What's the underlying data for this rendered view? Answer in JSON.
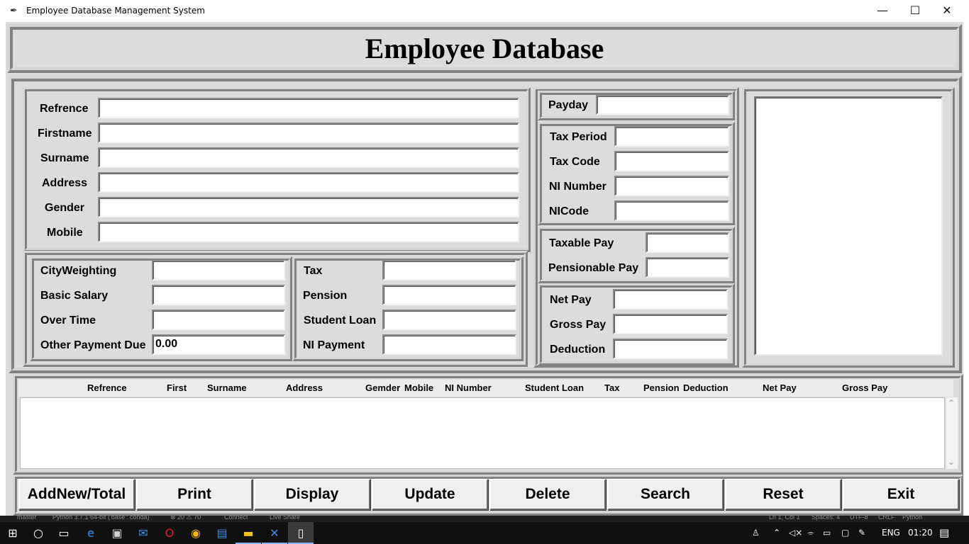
{
  "window": {
    "title": "Employee Database Management System",
    "minimize": "—",
    "maximize": "☐",
    "close": "✕"
  },
  "header": {
    "title": "Employee Database"
  },
  "personal": {
    "fields": [
      {
        "label": "Refrence",
        "value": ""
      },
      {
        "label": "Firstname",
        "value": ""
      },
      {
        "label": "Surname",
        "value": ""
      },
      {
        "label": "Address",
        "value": ""
      },
      {
        "label": "Gender",
        "value": ""
      },
      {
        "label": "Mobile",
        "value": ""
      }
    ]
  },
  "salary": {
    "fields": [
      {
        "label": "CityWeighting",
        "value": ""
      },
      {
        "label": "Basic Salary",
        "value": ""
      },
      {
        "label": "Over Time",
        "value": ""
      },
      {
        "label": "Other Payment Due",
        "value": "0.00"
      }
    ]
  },
  "deductions": {
    "fields": [
      {
        "label": "Tax",
        "value": ""
      },
      {
        "label": "Pension",
        "value": ""
      },
      {
        "label": "Student Loan",
        "value": ""
      },
      {
        "label": "NI Payment",
        "value": ""
      }
    ]
  },
  "payday": {
    "label": "Payday",
    "value": ""
  },
  "taxinfo": {
    "fields": [
      {
        "label": "Tax Period",
        "value": ""
      },
      {
        "label": "Tax Code",
        "value": ""
      },
      {
        "label": "NI Number",
        "value": ""
      },
      {
        "label": "NICode",
        "value": ""
      }
    ]
  },
  "taxable": {
    "fields": [
      {
        "label": "Taxable Pay",
        "value": ""
      },
      {
        "label": "Pensionable Pay",
        "value": ""
      }
    ]
  },
  "netpay": {
    "fields": [
      {
        "label": "Net Pay",
        "value": ""
      },
      {
        "label": "Gross Pay",
        "value": ""
      },
      {
        "label": "Deduction",
        "value": ""
      }
    ]
  },
  "table": {
    "headers": [
      "Refrence",
      "First",
      "Surname",
      "Address",
      "Gemder",
      "Mobile",
      "NI Number",
      "Student Loan",
      "Tax",
      "Pension",
      "Deduction",
      "Net Pay",
      "Gross Pay"
    ],
    "scroll_up": "⌃",
    "scroll_down": "⌄"
  },
  "buttons": [
    "AddNew/Total",
    "Print",
    "Display",
    "Update",
    "Delete",
    "Search",
    "Reset",
    "Exit"
  ],
  "statusbar": {
    "items": [
      "master",
      "Python 3.7.1 64-bit ('base': conda)",
      "⊗ 20 ⚠ 70",
      "Connect",
      "Live Share",
      "Ln 1, Col 1",
      "Spaces: 4",
      "UTF-8",
      "CRLF",
      "Python"
    ]
  },
  "taskbar": {
    "language": "ENG",
    "time": "01:20"
  },
  "icons": {
    "title": "feather-icon",
    "start": "windows-start-icon"
  }
}
